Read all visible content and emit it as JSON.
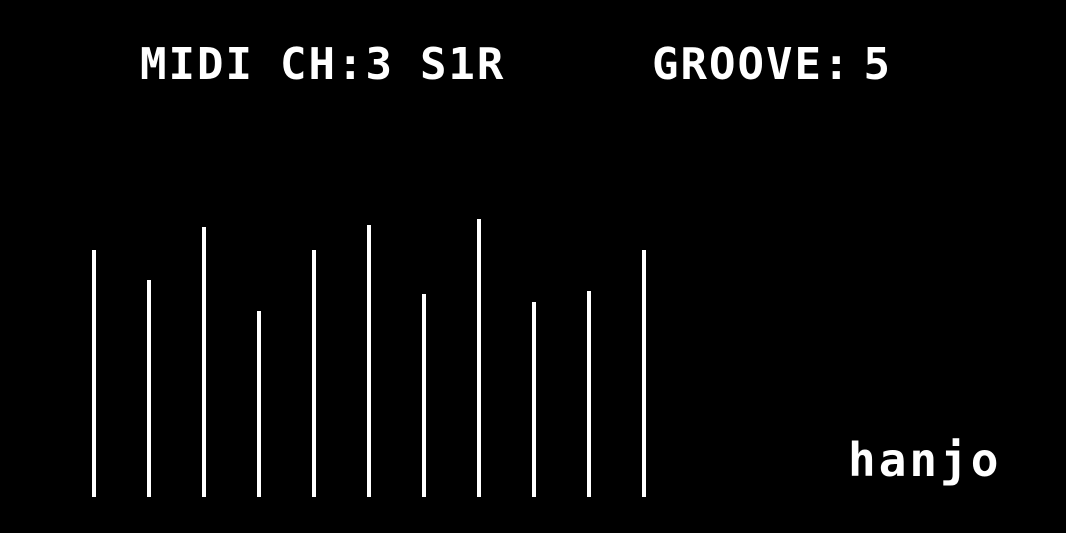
{
  "header": {
    "midi_label": "MIDI",
    "channel_text": "CH:3",
    "mode_text": "S1R",
    "groove_label": "GROOVE:",
    "groove_value": "5"
  },
  "sample_name": "hanjo",
  "colors": {
    "background": "#000000",
    "foreground": "#ffffff"
  },
  "levels": {
    "scale_max": 1.0,
    "values": [
      0.89,
      0.78,
      0.97,
      0.67,
      0.89,
      0.98,
      0.73,
      1.0,
      0.7,
      0.74,
      0.89
    ]
  }
}
